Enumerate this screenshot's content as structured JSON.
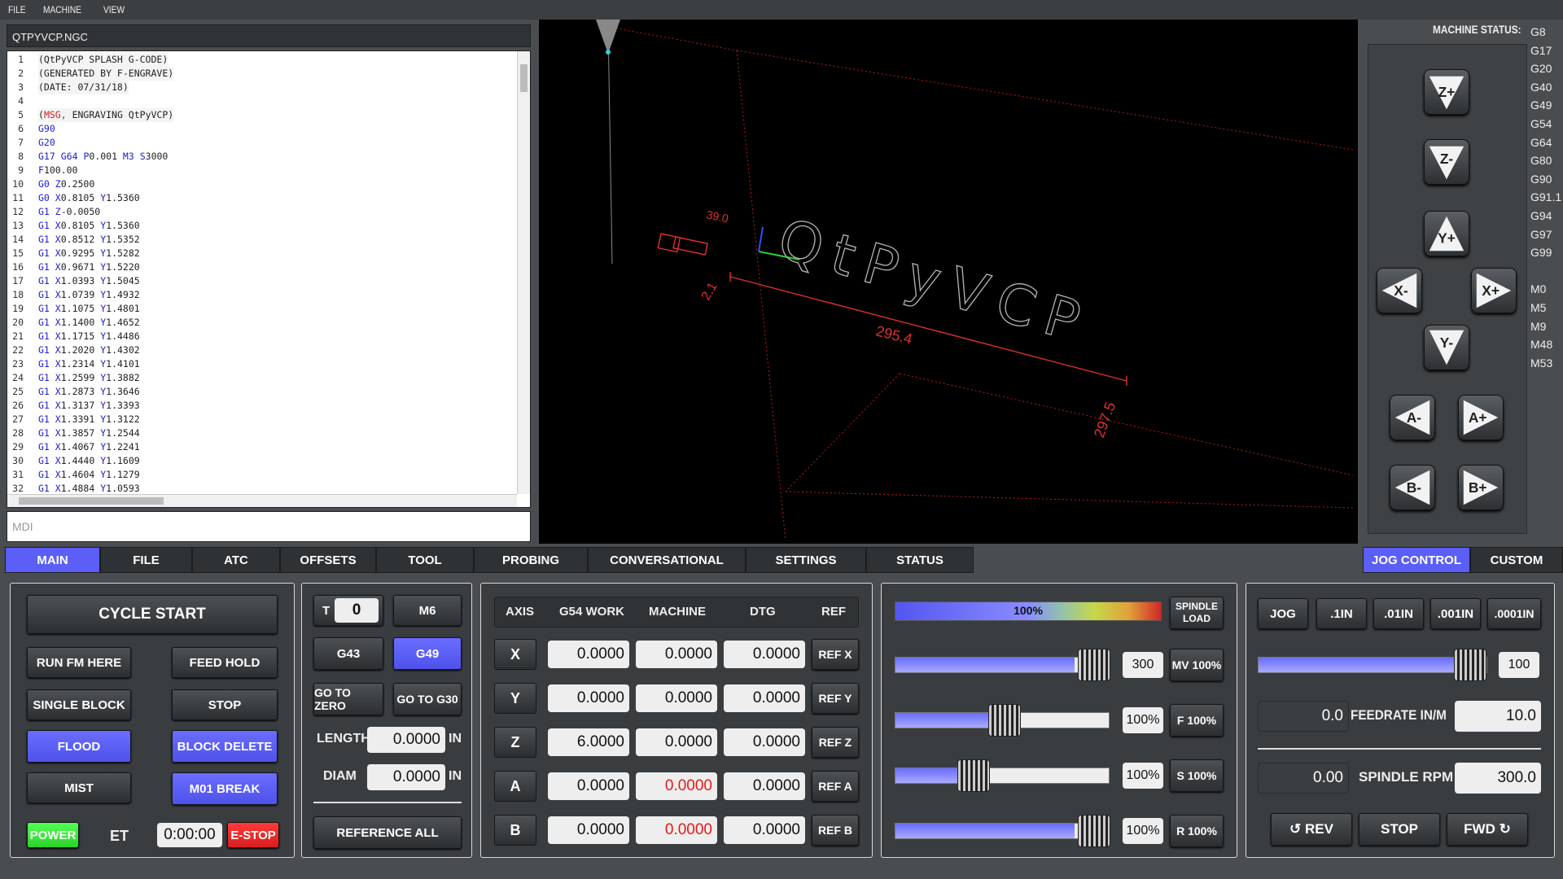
{
  "menu": [
    "FILE",
    "MACHINE",
    "VIEW"
  ],
  "file_name": "QTPYVCP.NGC",
  "mdi_placeholder": "MDI",
  "gcode_lines": [
    [
      "1",
      "(QtPyVCP SPLASH G-CODE)"
    ],
    [
      "2",
      "(GENERATED BY F-ENGRAVE)"
    ],
    [
      "3",
      "(DATE: 07/31/18)"
    ],
    [
      "4",
      ""
    ],
    [
      "5",
      "(MSG, ENGRAVING QtPyVCP)"
    ],
    [
      "6",
      "G90"
    ],
    [
      "7",
      "G20"
    ],
    [
      "8",
      "G17 G64 P0.001 M3 S3000"
    ],
    [
      "9",
      "F100.00"
    ],
    [
      "10",
      "G0 Z0.2500"
    ],
    [
      "11",
      "G0 X0.8105 Y1.5360"
    ],
    [
      "12",
      "G1 Z-0.0050"
    ],
    [
      "13",
      "G1 X0.8105 Y1.5360"
    ],
    [
      "14",
      "G1 X0.8512 Y1.5352"
    ],
    [
      "15",
      "G1 X0.9295 Y1.5282"
    ],
    [
      "16",
      "G1 X0.9671 Y1.5220"
    ],
    [
      "17",
      "G1 X1.0393 Y1.5045"
    ],
    [
      "18",
      "G1 X1.0739 Y1.4932"
    ],
    [
      "19",
      "G1 X1.1075 Y1.4801"
    ],
    [
      "20",
      "G1 X1.1400 Y1.4652"
    ],
    [
      "21",
      "G1 X1.1715 Y1.4486"
    ],
    [
      "22",
      "G1 X1.2020 Y1.4302"
    ],
    [
      "23",
      "G1 X1.2314 Y1.4101"
    ],
    [
      "24",
      "G1 X1.2599 Y1.3882"
    ],
    [
      "25",
      "G1 X1.2873 Y1.3646"
    ],
    [
      "26",
      "G1 X1.3137 Y1.3393"
    ],
    [
      "27",
      "G1 X1.3391 Y1.3122"
    ],
    [
      "28",
      "G1 X1.3857 Y1.2544"
    ],
    [
      "29",
      "G1 X1.4067 Y1.2241"
    ],
    [
      "30",
      "G1 X1.4440 Y1.1609"
    ],
    [
      "31",
      "G1 X1.4604 Y1.1279"
    ],
    [
      "32",
      "G1 X1.4884 Y1.0593"
    ]
  ],
  "view3d": {
    "dim_x": "295.4",
    "dim_y": "297.5",
    "dim_small": "2.1",
    "dim_top": "39.0",
    "text": "QtPyVCP"
  },
  "machine_status_label": "MACHINE STATUS:",
  "active_codes": [
    "G8",
    "G17",
    "G20",
    "G40",
    "G49",
    "G54",
    "G64",
    "G80",
    "G90",
    "G91.1",
    "G94",
    "G97",
    "G99",
    "",
    "M0",
    "M5",
    "M9",
    "M48",
    "M53"
  ],
  "jog_buttons": [
    "Z+",
    "Z-",
    "Y+",
    "X-",
    "X+",
    "Y-",
    "A-",
    "A+",
    "B-",
    "B+"
  ],
  "tabs": [
    "MAIN",
    "FILE",
    "ATC",
    "OFFSETS",
    "TOOL",
    "PROBING",
    "CONVERSATIONAL",
    "SETTINGS",
    "STATUS"
  ],
  "right_tabs": [
    "JOG CONTROL",
    "CUSTOM"
  ],
  "main": {
    "cycle_start": "CYCLE START",
    "run_from_here": "RUN FM HERE",
    "feed_hold": "FEED HOLD",
    "single_block": "SINGLE BLOCK",
    "stop": "STOP",
    "flood": "FLOOD",
    "block_delete": "BLOCK DELETE",
    "mist": "MIST",
    "m01_break": "M01 BREAK",
    "power": "POWER",
    "et_label": "ET",
    "et_value": "0:00:00",
    "estop": "E-STOP"
  },
  "tool": {
    "t_label": "T",
    "t_value": "0",
    "m6": "M6",
    "g43": "G43",
    "g49": "G49",
    "go_to_zero": "GO TO ZERO",
    "go_to_g30": "GO TO G30",
    "length_label": "LENGTH",
    "length_value": "0.0000",
    "diam_label": "DIAM",
    "diam_value": "0.0000",
    "unit": "IN",
    "reference_all": "REFERENCE ALL"
  },
  "dro": {
    "headers": [
      "AXIS",
      "G54 WORK",
      "MACHINE",
      "DTG",
      "REF"
    ],
    "rows": [
      {
        "axis": "X",
        "work": "0.0000",
        "machine": "0.0000",
        "dtg": "0.0000",
        "ref": "REF X"
      },
      {
        "axis": "Y",
        "work": "0.0000",
        "machine": "0.0000",
        "dtg": "0.0000",
        "ref": "REF Y"
      },
      {
        "axis": "Z",
        "work": "6.0000",
        "machine": "0.0000",
        "dtg": "0.0000",
        "ref": "REF Z"
      },
      {
        "axis": "A",
        "work": "0.0000",
        "machine": "0.0000",
        "dtg": "0.0000",
        "ref": "REF A"
      },
      {
        "axis": "B",
        "work": "0.0000",
        "machine": "0.0000",
        "dtg": "0.0000",
        "ref": "REF B"
      }
    ],
    "warn_color": "#e81818"
  },
  "overrides": {
    "spindle_load_pct": "100%",
    "spindle_load_label": "SPINDLE LOAD",
    "mv_value": "300",
    "mv_btn": "MV 100%",
    "f_value": "100%",
    "f_btn": "F 100%",
    "s_value": "100%",
    "s_btn": "S 100%",
    "r_value": "100%",
    "r_btn": "R 100%"
  },
  "jog": {
    "jog": "JOG",
    "steps": [
      ".1IN",
      ".01IN",
      ".001IN",
      ".0001IN"
    ],
    "speed": "100",
    "feed_actual": "0.0",
    "feed_label": "FEEDRATE IN/M",
    "feed_set": "10.0",
    "rpm_actual": "0.00",
    "rpm_label": "SPINDLE RPM",
    "rpm_set": "300.0",
    "rev": "↺ REV",
    "stop": "STOP",
    "fwd": "FWD ↻"
  },
  "colors": {
    "accent": "#5b5ef7",
    "power": "#33e833",
    "estop": "#e02424"
  }
}
